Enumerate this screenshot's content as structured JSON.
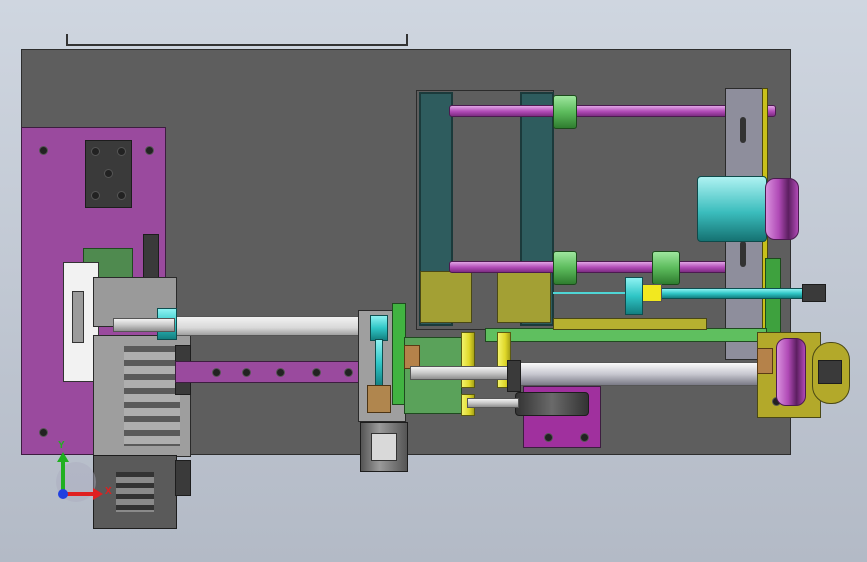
{
  "viewport": {
    "background_top": "#cfd6e0",
    "background_bottom": "#b3bac6"
  },
  "colors": {
    "base_plate": "#5e5e5e",
    "magenta_plate": "#9a4a9e",
    "guide_rod": "#b04ab6",
    "collar": "#5cbb5c",
    "yellow_spacer": "#e0d82a",
    "cyan_rod": "#2fc6c6",
    "olive_block": "#a3a034",
    "teal_frame": "#2e5c5e"
  },
  "triad": {
    "x_label": "X",
    "y_label": "Y",
    "x_color": "#e02020",
    "y_color": "#20b020",
    "z_color": "#2040e0"
  }
}
